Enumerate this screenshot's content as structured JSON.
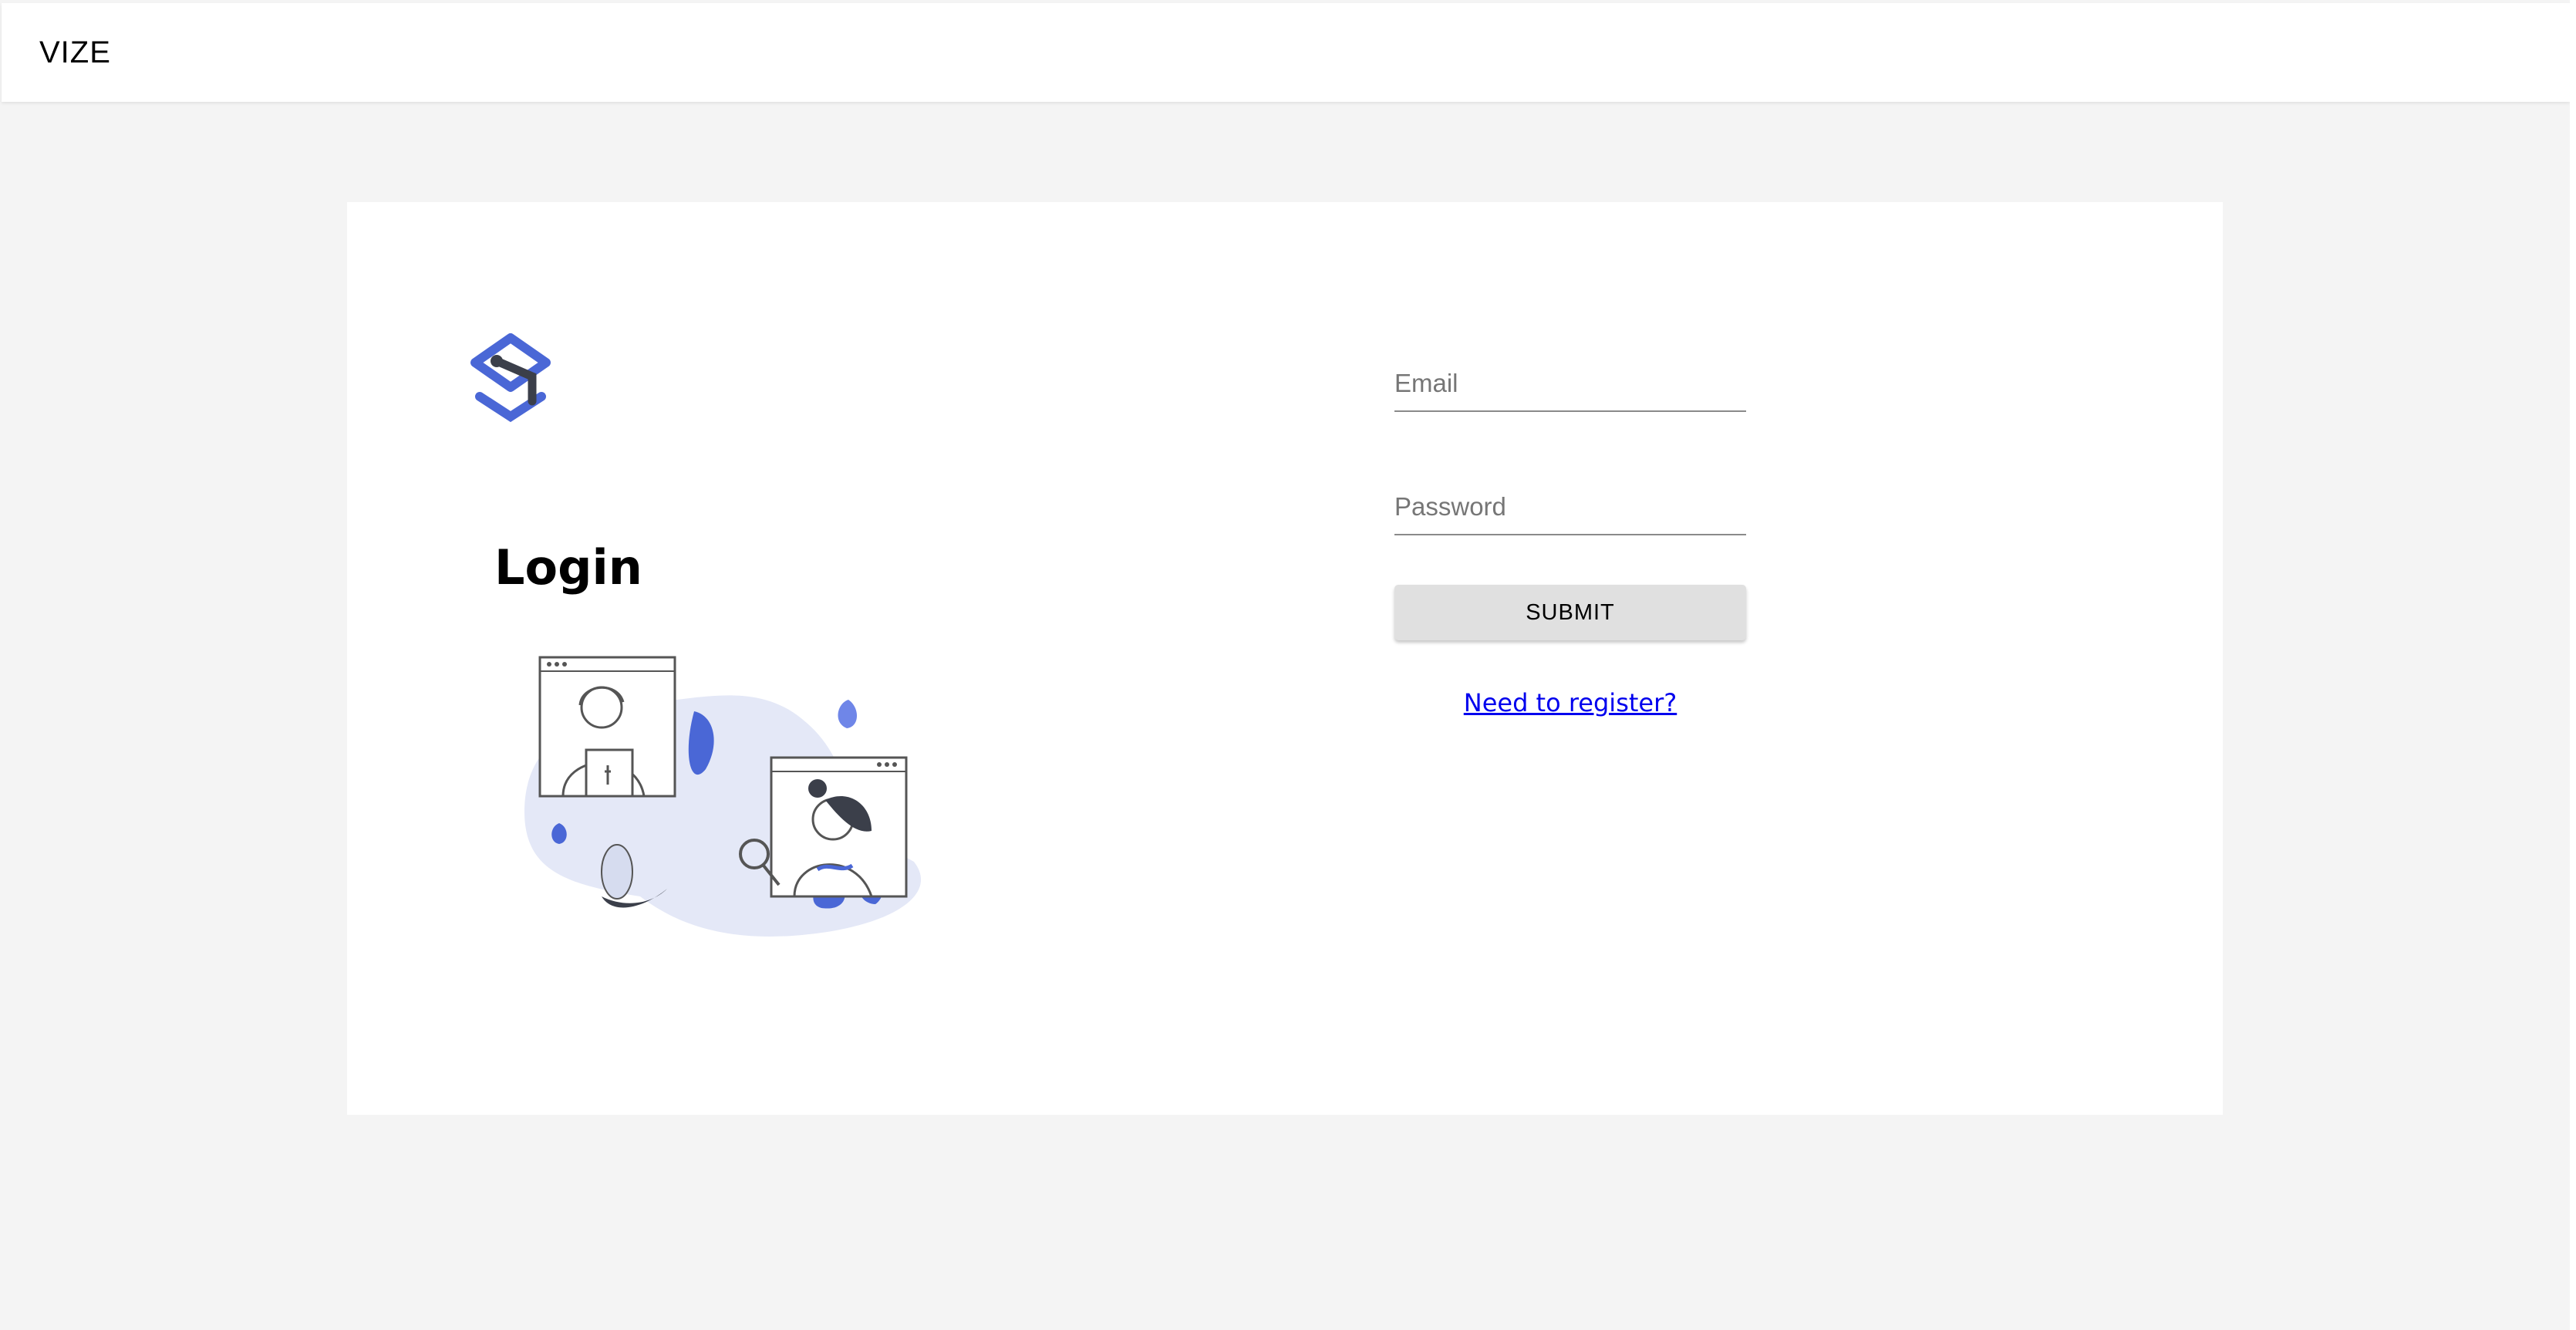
{
  "header": {
    "brand": "VIZE"
  },
  "login": {
    "title": "Login",
    "email_placeholder": "Email",
    "password_placeholder": "Password",
    "submit_label": "SUBMIT",
    "register_link": "Need to register?"
  },
  "icons": {
    "logo": "graduation-cap-icon",
    "illustration": "people-windows-illustration"
  },
  "colors": {
    "accent": "#4a67d6",
    "background": "#f4f4f4",
    "card": "#ffffff"
  }
}
